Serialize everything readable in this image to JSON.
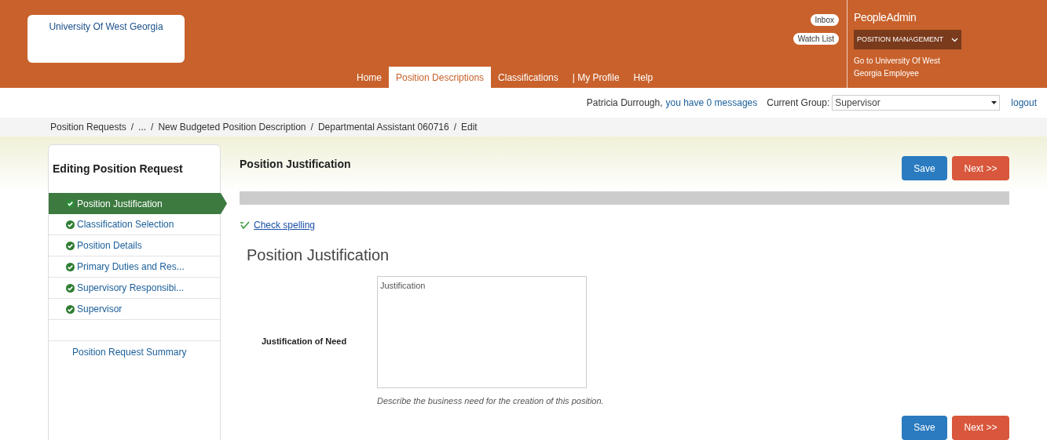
{
  "header": {
    "logo_text": "University Of West Georgia",
    "inbox": "Inbox",
    "watch_list": "Watch List",
    "brand": "PeopleAdmin",
    "module_menu": "POSITION MANAGEMENT",
    "portal_link": "Go to University Of West Georgia Employee",
    "nav": [
      {
        "label": "Home",
        "selected": false
      },
      {
        "label": "Position Descriptions",
        "selected": true
      },
      {
        "label": "Classifications",
        "selected": false
      },
      {
        "label": "| My Profile",
        "selected": false
      },
      {
        "label": "Help",
        "selected": false
      }
    ]
  },
  "user_bar": {
    "user": "Patricia Durrough,",
    "messages": "you have 0 messages",
    "group_label": "Current Group:",
    "group": "Supervisor",
    "logout": "logout"
  },
  "breadcrumbs": [
    {
      "label": "Position Requests"
    },
    {
      "separator": "/",
      "label": "..."
    },
    {
      "separator": "/",
      "label": "New Budgeted Position Description"
    },
    {
      "separator": "/",
      "label": "Departmental Assistant 060716"
    },
    {
      "separator": "/",
      "label": "Edit"
    }
  ],
  "sidebar": {
    "title": "Editing Position Request",
    "items": [
      {
        "label": "Position Justification",
        "selected": true,
        "complete": true
      },
      {
        "label": "Classification Selection",
        "selected": false,
        "complete": true
      },
      {
        "label": "Position Details",
        "selected": false,
        "complete": true
      },
      {
        "label": "Primary Duties and Res...",
        "selected": false,
        "complete": true
      },
      {
        "label": "Supervisory Responsibi...",
        "selected": false,
        "complete": true
      },
      {
        "label": "Supervisor",
        "selected": false,
        "complete": true
      }
    ],
    "summary": "Position Request Summary"
  },
  "main": {
    "title": "Position Justification",
    "save": "Save",
    "next": "Next >>",
    "spell_check": "Check spelling",
    "section_title": "Position Justification",
    "field_label": "Justification of Need",
    "field_value": "Justification",
    "help": "Describe the business need for the creation of this position.",
    "bottom_save": "Save",
    "bottom_next": "Next >>"
  }
}
